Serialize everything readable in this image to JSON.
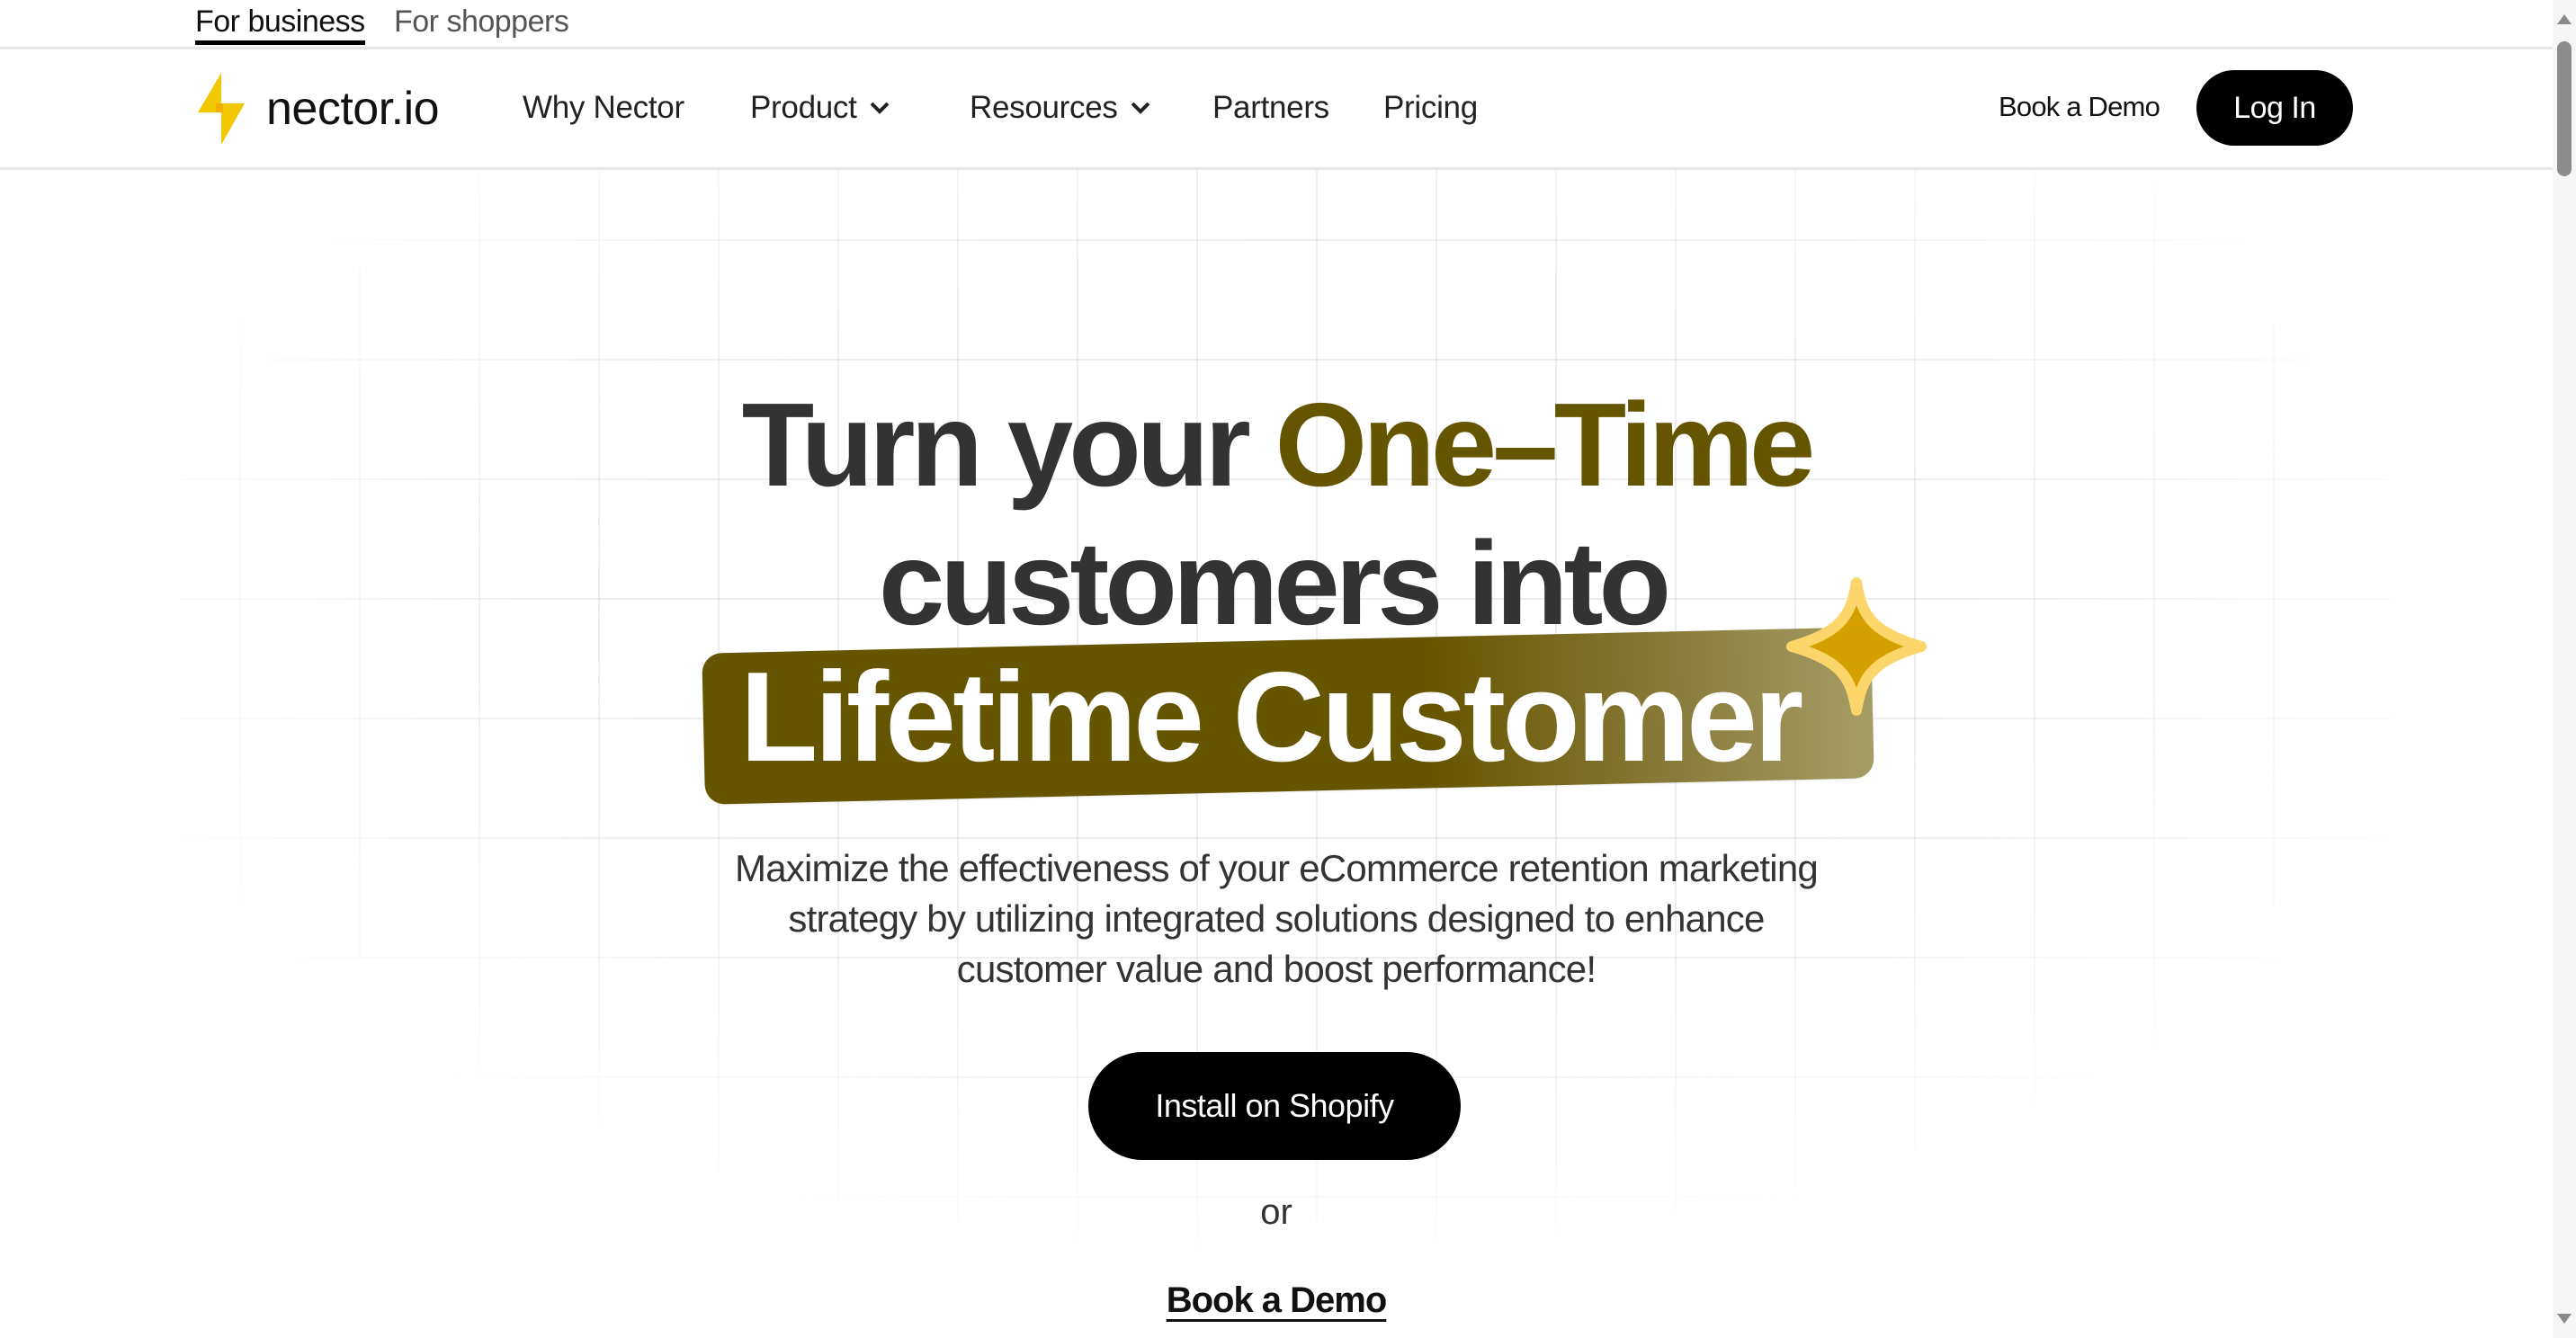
{
  "top_tabs": [
    {
      "label": "For business",
      "active": true
    },
    {
      "label": "For shoppers",
      "active": false
    }
  ],
  "brand": {
    "name": "nector.io",
    "logo_icon": "lightning-bolt-icon",
    "logo_color": "#f2c800"
  },
  "nav": {
    "items": [
      {
        "label": "Why Nector",
        "has_dropdown": false
      },
      {
        "label": "Product",
        "has_dropdown": true
      },
      {
        "label": "Resources",
        "has_dropdown": true
      },
      {
        "label": "Partners",
        "has_dropdown": false
      },
      {
        "label": "Pricing",
        "has_dropdown": false
      }
    ],
    "book_demo_label": "Book a Demo",
    "login_label": "Log In"
  },
  "hero": {
    "headline_prefix": "Turn your ",
    "headline_accent": "One–Time",
    "headline_line2": "customers into",
    "highlight_text": "Lifetime Customer",
    "subtext_lines": [
      "Maximize the effectiveness of your eCommerce retention marketing",
      "strategy by utilizing integrated solutions designed to enhance",
      "customer value and boost performance!"
    ],
    "primary_cta": "Install on Shopify",
    "separator": "or",
    "secondary_cta": "Book a Demo"
  },
  "colors": {
    "accent": "#665500",
    "band_end": "#a59d66",
    "sparkle_fill": "#d4a000",
    "sparkle_stroke": "#fcd66a",
    "text_dark": "#333333",
    "button_bg": "#000000"
  }
}
